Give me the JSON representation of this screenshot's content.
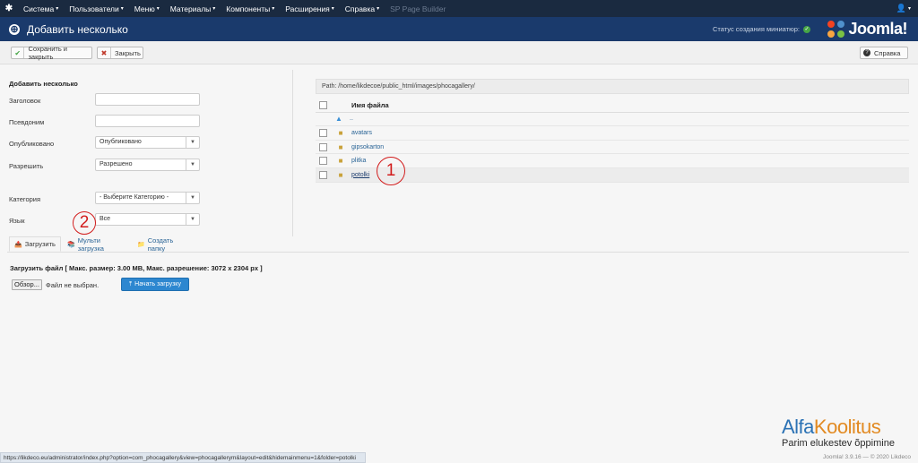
{
  "topnav": {
    "logo_icon": "joomla-icon",
    "items": [
      {
        "label": "Система",
        "caret": "▾"
      },
      {
        "label": "Пользователи",
        "caret": "▾"
      },
      {
        "label": "Меню",
        "caret": "▾"
      },
      {
        "label": "Материалы",
        "caret": "▾"
      },
      {
        "label": "Компоненты",
        "caret": "▾"
      },
      {
        "label": "Расширения",
        "caret": "▾"
      },
      {
        "label": "Справка",
        "caret": "▾"
      },
      {
        "label": "SP Page Builder",
        "caret": ""
      }
    ],
    "user_icon": "👤",
    "user_caret": "▾"
  },
  "header": {
    "title": "Добавить несколько",
    "title_icon": "⊕",
    "status_label": "Статус создания миниатюр:",
    "status_ok": "✓",
    "brand": "Joomla!"
  },
  "toolbar": {
    "save_close": {
      "label": "Сохранить и закрыть",
      "icon": "✔"
    },
    "close": {
      "label": "Закрыть",
      "icon": "✖"
    },
    "help": {
      "label": "Справка",
      "icon": "?"
    }
  },
  "form": {
    "section_title": "Добавить несколько",
    "fields": [
      {
        "label": "Заголовок",
        "value": ""
      },
      {
        "label": "Псевдоним",
        "value": ""
      }
    ],
    "published": {
      "label": "Опубликовано",
      "value": "Опубликовано"
    },
    "allow": {
      "label": "Разрешить",
      "value": "Разрешено"
    },
    "category": {
      "label": "Категория",
      "value": "- Выберите Категорию -"
    },
    "language": {
      "label": "Язык",
      "value": "Все"
    }
  },
  "browser": {
    "path": "Path: /home/likdecoe/public_html/images/phocagallery/",
    "column_header": "Имя файла",
    "up_label": "..",
    "folders": [
      "avatars",
      "gipsokarton",
      "plitka",
      "potolki"
    ]
  },
  "tabs": [
    {
      "label": "Загрузить",
      "icon": "📤"
    },
    {
      "label": "Мульти загрузка",
      "icon": "📚"
    },
    {
      "label": "Создать папку",
      "icon": "📁"
    }
  ],
  "upload": {
    "title": "Загрузить файл [ Макс. размер: 3.00 MB, Макс. разрешение: 3072 x 2304 px ]",
    "browse_label": "Обзор...",
    "no_file": "Файл не выбран.",
    "start_label": "Начать загрузку",
    "start_icon": "⤒"
  },
  "annotations": [
    "1",
    "2"
  ],
  "statusbar": {
    "url": "https://likdeco.eu/administrator/index.php?option=com_phocagallery&view=phocagallerym&layout=edit&hidemainmenu=1&folder=potolki"
  },
  "footer": {
    "version": "Joomla! 3.9.16 — © 2020 Likdeco"
  },
  "watermark": {
    "part_a": "Alfa",
    "part_b": "Koolitus",
    "slogan": "Parim elukestev õppimine"
  },
  "colors": {
    "topnav": "#1a2a40",
    "header": "#1a3a6c",
    "link": "#2a6496",
    "primary_button": "#2d87d0",
    "annotation": "#d21c1c"
  }
}
